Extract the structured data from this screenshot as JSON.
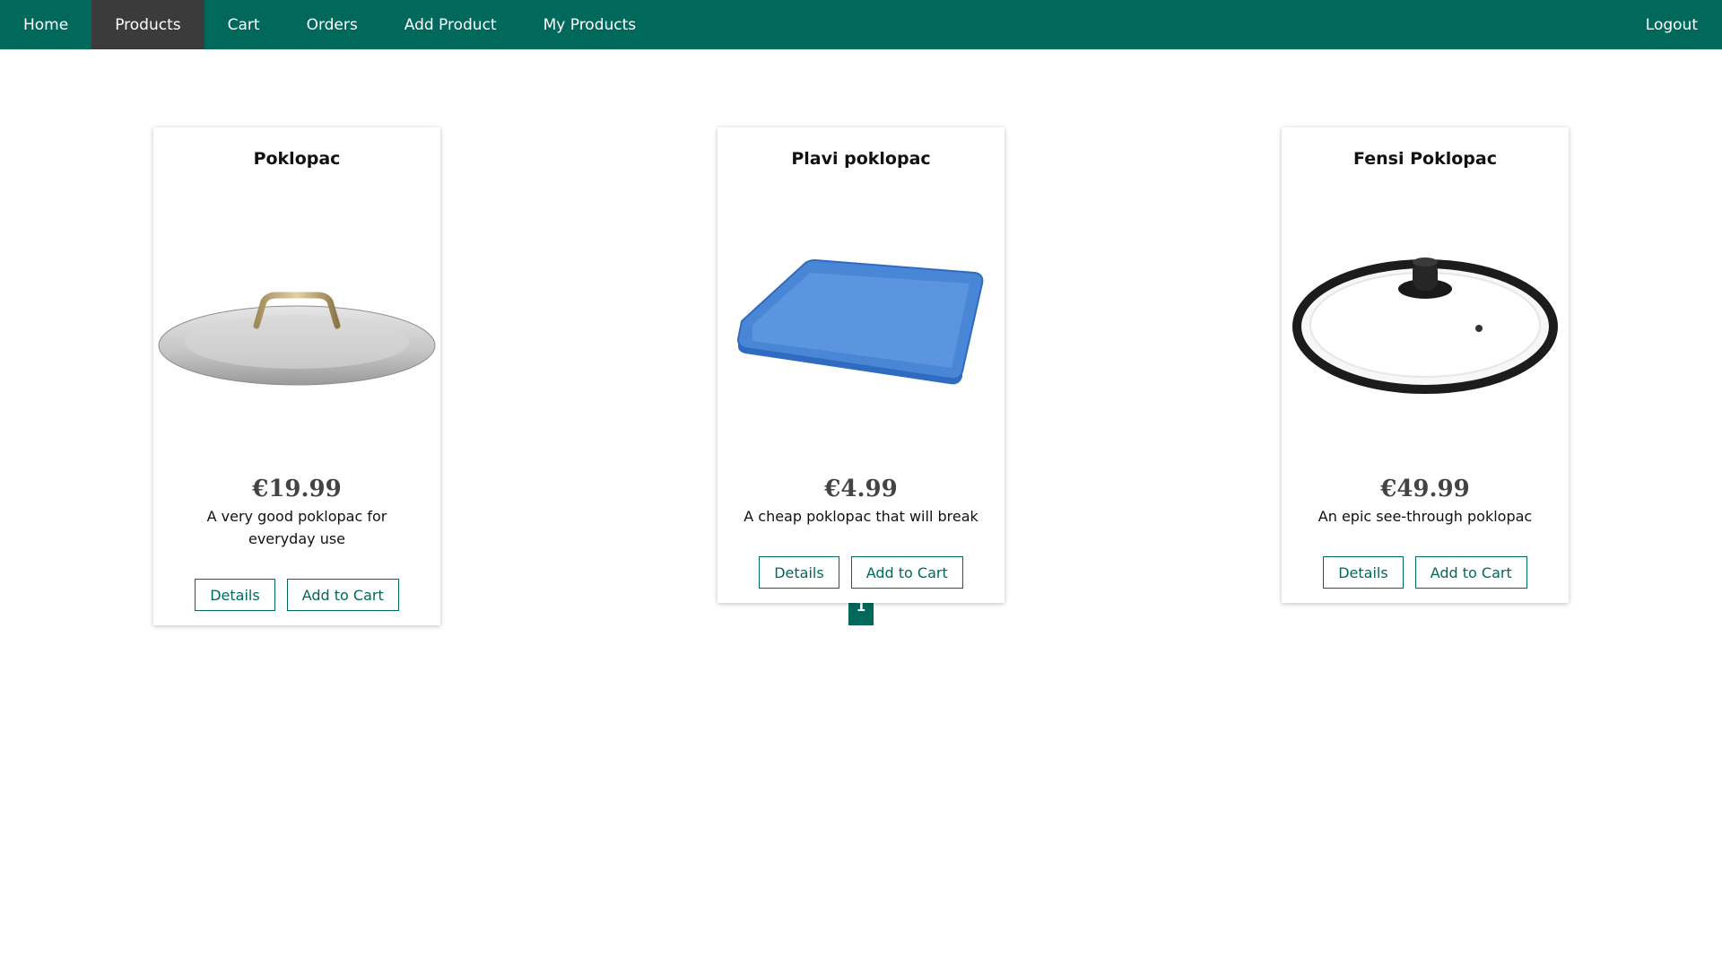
{
  "nav": {
    "items": [
      "Home",
      "Products",
      "Cart",
      "Orders",
      "Add Product",
      "My Products"
    ],
    "active": "Products",
    "logout": "Logout"
  },
  "products": [
    {
      "name": "Poklopac",
      "price": "€19.99",
      "description": "A very good poklopac for everyday use",
      "details_label": "Details",
      "cart_label": "Add to Cart"
    },
    {
      "name": "Plavi poklopac",
      "price": "€4.99",
      "description": "A cheap poklopac that will break",
      "details_label": "Details",
      "cart_label": "Add to Cart"
    },
    {
      "name": "Fensi Poklopac",
      "price": "€49.99",
      "description": "An epic see-through poklopac",
      "details_label": "Details",
      "cart_label": "Add to Cart"
    }
  ],
  "pagination": {
    "current": "1"
  },
  "colors": {
    "primary": "#00695c",
    "nav_active": "#3b3b3b"
  }
}
